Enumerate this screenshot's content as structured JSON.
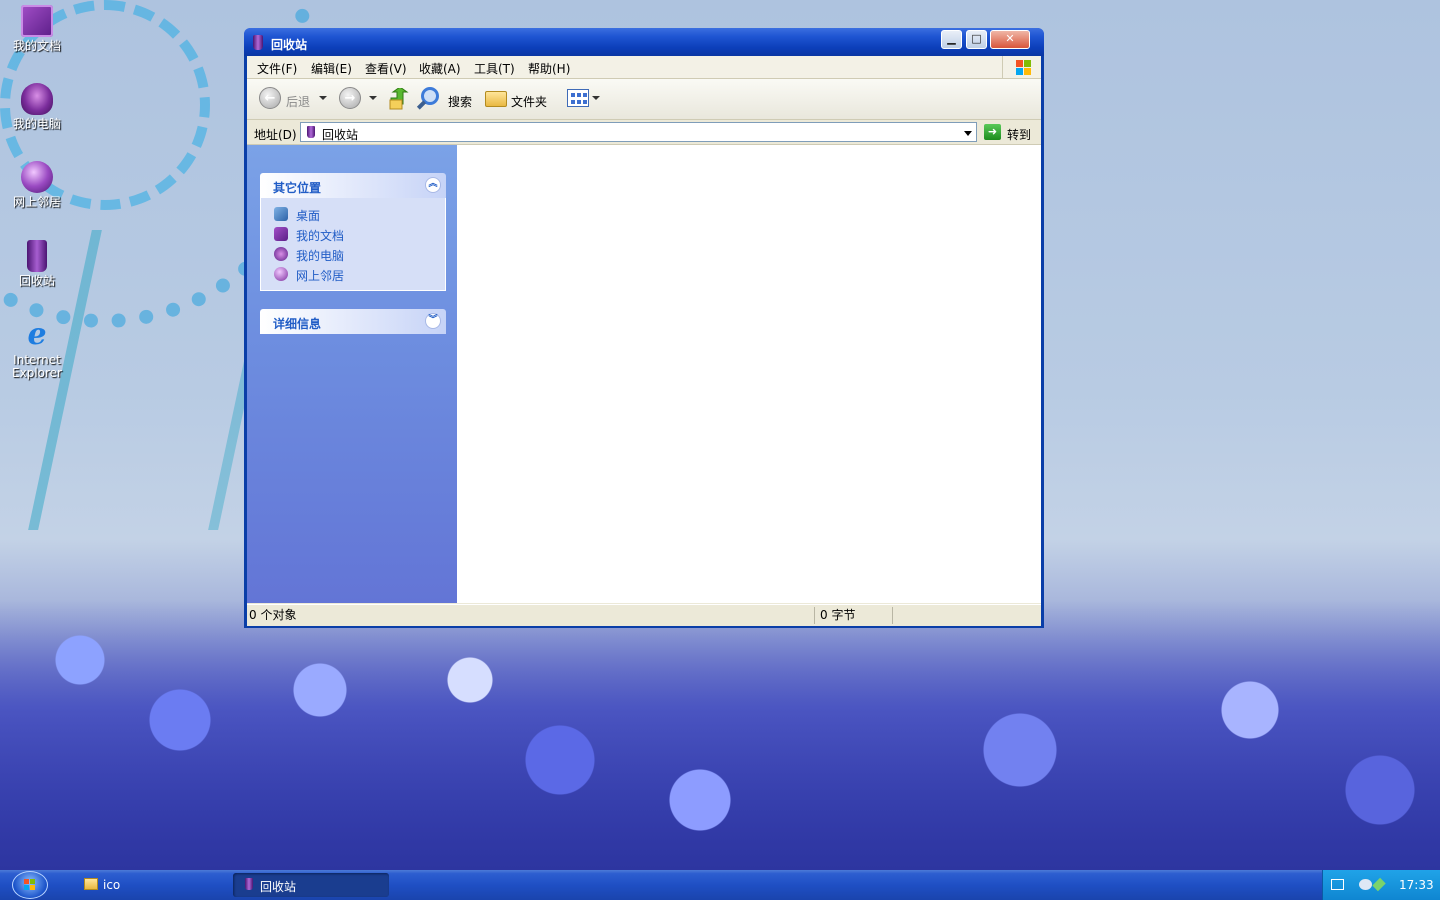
{
  "desktop": {
    "icons": [
      {
        "label": "我的文档"
      },
      {
        "label": "我的电脑"
      },
      {
        "label": "网上邻居"
      },
      {
        "label": "回收站"
      },
      {
        "label": "Internet Explorer",
        "line1": "Internet",
        "line2": "Explorer"
      }
    ]
  },
  "window": {
    "title": "回收站",
    "menu": [
      "文件(F)",
      "编辑(E)",
      "查看(V)",
      "收藏(A)",
      "工具(T)",
      "帮助(H)"
    ],
    "toolbar": {
      "back": "后退",
      "search": "搜索",
      "folders": "文件夹"
    },
    "address": {
      "label": "地址(D)",
      "value": "回收站",
      "go": "转到"
    },
    "taskpane": {
      "other_places": {
        "title": "其它位置",
        "items": [
          "桌面",
          "我的文档",
          "我的电脑",
          "网上邻居"
        ]
      },
      "details": {
        "title": "详细信息"
      }
    },
    "status": {
      "objects": "0 个对象",
      "size": "0 字节"
    }
  },
  "taskbar": {
    "tasks": [
      "ico",
      "回收站"
    ],
    "clock": "17:33"
  },
  "colors": {
    "title_blue": "#0a3ea8",
    "taskpane_link": "#215dc6",
    "taskpane_bg": "#6e8fe0"
  }
}
